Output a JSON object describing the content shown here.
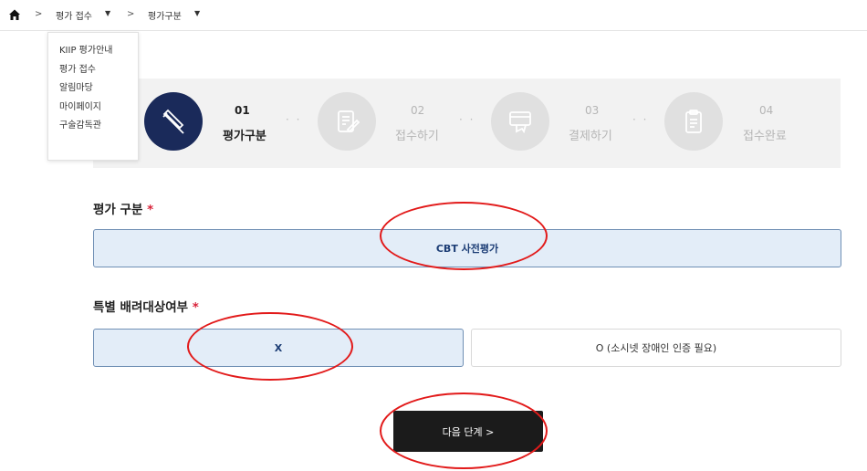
{
  "breadcrumb": {
    "items": [
      "평가 접수",
      "평가구분"
    ],
    "separator": ">",
    "caret": "▼"
  },
  "dropdown": {
    "items": [
      "KIIP 평가안내",
      "평가 접수",
      "알림마당",
      "마이페이지",
      "구술감독관"
    ]
  },
  "steps": [
    {
      "num": "01",
      "label": "평가구분",
      "active": true,
      "icon": "pen-icon"
    },
    {
      "num": "02",
      "label": "접수하기",
      "active": false,
      "icon": "document-edit-icon"
    },
    {
      "num": "03",
      "label": "결제하기",
      "active": false,
      "icon": "card-payment-icon"
    },
    {
      "num": "04",
      "label": "접수완료",
      "active": false,
      "icon": "clipboard-icon"
    }
  ],
  "step_connector": "· ·",
  "sections": {
    "eval_type": {
      "title": "평가 구분",
      "required_mark": "*",
      "options": [
        "CBT 사전평가"
      ],
      "selected": "CBT 사전평가"
    },
    "special_care": {
      "title": "특별 배려대상여부",
      "required_mark": "*",
      "options": [
        "X",
        "O (소시넷 장애인 인증 필요)"
      ],
      "selected": "X"
    }
  },
  "next_button": {
    "label": "다음 단계 >"
  },
  "colors": {
    "active_step": "#1a2a5a",
    "selected_bg": "#e3edf8",
    "selected_border": "#6f8fb4",
    "annotation": "#e21a1a",
    "required": "#d9233a"
  }
}
